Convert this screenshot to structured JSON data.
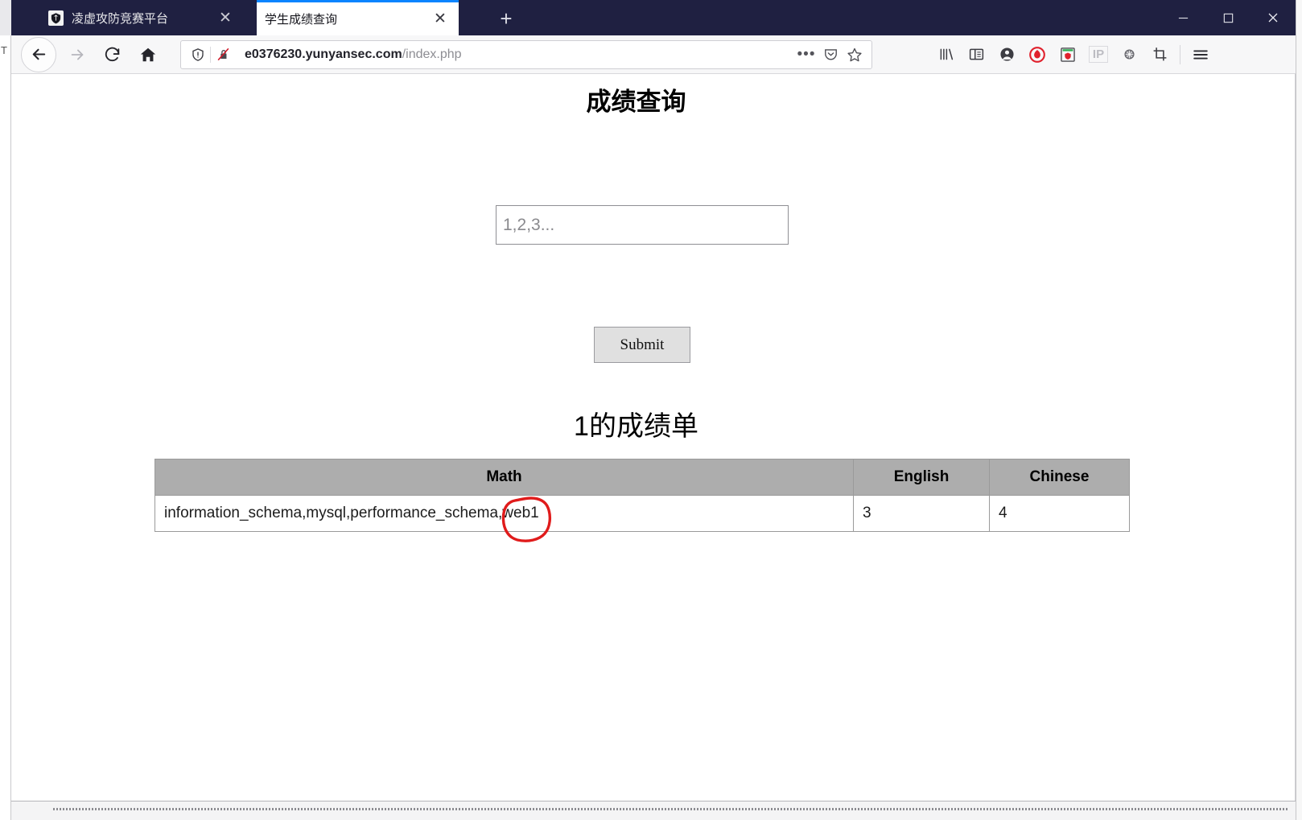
{
  "browser": {
    "tabs": [
      {
        "title": "凌虚攻防竞赛平台",
        "active": false,
        "favicon": "shield-icon",
        "close_label": "✕"
      },
      {
        "title": "学生成绩查询",
        "active": true,
        "favicon": "none",
        "close_label": "✕"
      }
    ],
    "new_tab_label": "+",
    "window_controls": {
      "minimize": "—",
      "maximize": "☐",
      "close": "✕"
    },
    "nav": {
      "back_label": "←",
      "forward_label": "→",
      "reload_label": "⟳",
      "home_label": "⌂"
    },
    "urlbar": {
      "shield_icon": "tracking-protection-shield-icon",
      "insecure_icon": "crossed-out-lock-icon",
      "domain": "e0376230.yunyansec.com",
      "path": "/index.php",
      "page_actions_label": "•••",
      "pocket_icon": "pocket-save-icon",
      "bookmark_icon": "star-bookmark-icon"
    },
    "toolbar_icons": [
      "library-icon",
      "sidebar-icon",
      "account-icon",
      "hackbar-shield-icon",
      "app-box-icon",
      "ip-icon",
      "spider-globe-icon",
      "screenshot-crop-icon"
    ],
    "toolbar_ip_label": "IP",
    "menu_label": "☰"
  },
  "page": {
    "title": "成绩查询",
    "input": {
      "value": "",
      "placeholder": "1,2,3..."
    },
    "submit_label": "Submit",
    "subtitle": "1的成绩单",
    "table": {
      "headers": [
        "Math",
        "English",
        "Chinese"
      ],
      "rows": [
        [
          "information_schema,mysql,performance_schema,web1",
          "3",
          "4"
        ]
      ]
    },
    "annotation": {
      "shape": "hand-drawn-red-circle",
      "target_text": "web1",
      "color": "#e01b1b"
    }
  }
}
